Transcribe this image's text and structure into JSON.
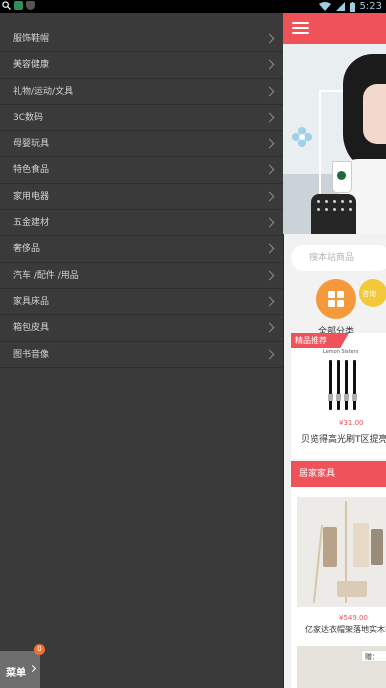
{
  "status_bar": {
    "time": "5:23"
  },
  "drawer": {
    "items": [
      {
        "label": "服饰鞋帽"
      },
      {
        "label": "美容健康"
      },
      {
        "label": "礼物/运动/文具"
      },
      {
        "label": "3C数码"
      },
      {
        "label": "母婴玩具"
      },
      {
        "label": "特色食品"
      },
      {
        "label": "家用电器"
      },
      {
        "label": "五金建材"
      },
      {
        "label": "奢侈品"
      },
      {
        "label": "汽车 /配件 /用品"
      },
      {
        "label": "家具床品"
      },
      {
        "label": "箱包皮具"
      },
      {
        "label": "图书音像"
      }
    ],
    "menu_button": {
      "label": "菜单",
      "badge": "0"
    }
  },
  "page": {
    "search_placeholder": "搜本站商品",
    "categories": {
      "all_label": "全部分类",
      "second_label": "咨询"
    },
    "featured": {
      "ribbon": "精品推荐",
      "brand": "Lemon Sisters",
      "price": "¥31.00",
      "name": "贝览得高光刷T区提亮"
    },
    "home_section": {
      "title": "居家家具",
      "price": "¥549.00",
      "name": "亿家达衣帽架落地实木衣",
      "gift": "赠："
    }
  },
  "colors": {
    "accent": "#f0525a",
    "drawer_bg": "#3a3a3a",
    "orange": "#f49a3b",
    "yellow": "#f3c83a"
  }
}
